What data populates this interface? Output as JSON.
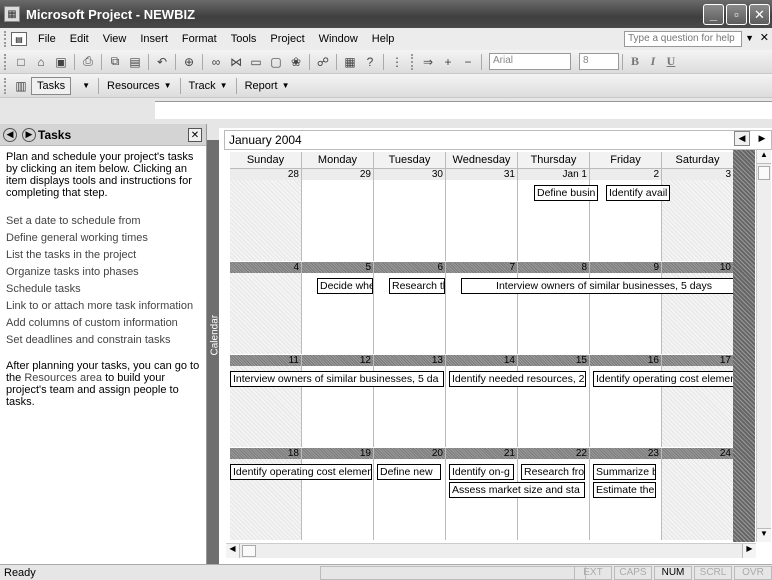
{
  "window": {
    "title": "Microsoft Project - NEWBIZ"
  },
  "menu": {
    "items": [
      "File",
      "Edit",
      "View",
      "Insert",
      "Format",
      "Tools",
      "Project",
      "Window",
      "Help"
    ],
    "help_placeholder": "Type a question for help"
  },
  "toolbar": {
    "font": "Arial",
    "size": "8",
    "bold": "B",
    "italic": "I",
    "underline": "U"
  },
  "guide_toolbar": {
    "tasks": "Tasks",
    "resources": "Resources",
    "track": "Track",
    "report": "Report"
  },
  "taskpane": {
    "title": "Tasks",
    "intro": "Plan and schedule your project's tasks by clicking an item below. Clicking an item displays tools and instructions for completing that step.",
    "links": [
      "Set a date to schedule from",
      "Define general working times",
      "List the tasks in the project",
      "Organize tasks into phases",
      "Schedule tasks",
      "Link to or attach more task information",
      "Add columns of custom information",
      "Set deadlines and constrain tasks"
    ],
    "after_1": "After planning your tasks, you can go to the ",
    "after_link": "Resources area",
    "after_2": " to build your project's team and assign people to tasks."
  },
  "calendar": {
    "month": "January 2004",
    "side_label": "Calendar",
    "days_of_week": [
      "Sunday",
      "Monday",
      "Tuesday",
      "Wednesday",
      "Thursday",
      "Friday",
      "Saturday"
    ],
    "weeks": [
      {
        "dates": [
          "28",
          "29",
          "30",
          "31",
          "Jan 1",
          "2",
          "3"
        ]
      },
      {
        "dates": [
          "4",
          "5",
          "6",
          "7",
          "8",
          "9",
          "10"
        ]
      },
      {
        "dates": [
          "11",
          "12",
          "13",
          "14",
          "15",
          "16",
          "17"
        ]
      },
      {
        "dates": [
          "18",
          "19",
          "20",
          "21",
          "22",
          "23",
          "24"
        ]
      }
    ],
    "tasks": {
      "w1_thu": "Define busin",
      "w1_fri": "Identify avail",
      "w2_mon": "Decide whet",
      "w2_tue": "Research th",
      "w2_interview": "Interview owners of similar businesses, 5 days",
      "w3_interview": "Interview owners of similar businesses, 5 da",
      "w3_identify_needed": "Identify needed resources, 2",
      "w3_identify_cost": "Identify operating cost elemen",
      "w4_identify_cost": "Identify operating cost elemen",
      "w4_define_new": "Define new",
      "w4_identify_on": "Identify on-g",
      "w4_research": "Research fro",
      "w4_summarize": "Summarize b",
      "w4_assess": "Assess market size and sta",
      "w4_estimate": "Estimate the"
    }
  },
  "status": {
    "text": "Ready",
    "flags": [
      "EXT",
      "CAPS",
      "NUM",
      "SCRL",
      "OVR"
    ]
  }
}
